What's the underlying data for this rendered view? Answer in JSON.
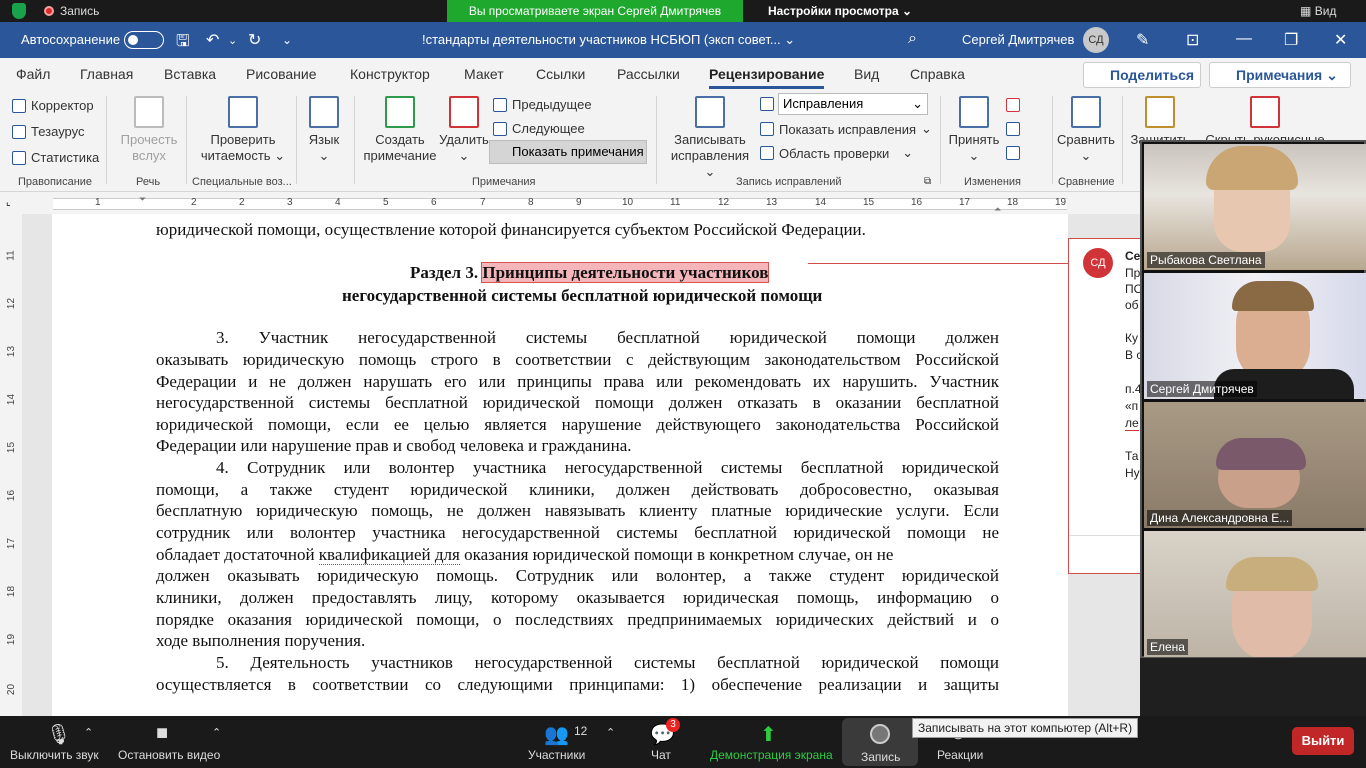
{
  "zoom_top": {
    "recording_label": "Запись",
    "viewing_banner": "Вы просматриваете экран Сергей Дмитрячев",
    "view_settings": "Настройки просмотра",
    "view_label": "Вид"
  },
  "word_title": {
    "autosave_label": "Автосохранение",
    "document_title": "!стандарты деятельности участников НСБЮП (эксп совет...",
    "user_name": "Сергей Дмитрячев",
    "user_initials": "СД"
  },
  "menu_tabs": [
    "Файл",
    "Главная",
    "Вставка",
    "Рисование",
    "Конструктор",
    "Макет",
    "Ссылки",
    "Рассылки",
    "Рецензирование",
    "Вид",
    "Справка"
  ],
  "share_button": "Поделиться",
  "comments_button": "Примечания",
  "ribbon": {
    "proofing": {
      "spelling": "Корректор",
      "thesaurus": "Тезаурус",
      "stats": "Статистика",
      "group": "Правописание"
    },
    "speech": {
      "read_aloud_1": "Прочесть",
      "read_aloud_2": "вслух",
      "group": "Речь"
    },
    "accessibility": {
      "check_1": "Проверить",
      "check_2": "читаемость",
      "group": "Специальные воз..."
    },
    "language": {
      "label": "Язык"
    },
    "comments": {
      "new_1": "Создать",
      "new_2": "примечание",
      "delete": "Удалить",
      "previous": "Предыдущее",
      "next": "Следующее",
      "show": "Показать примечания",
      "group": "Примечания"
    },
    "tracking": {
      "track_1": "Записывать",
      "track_2": "исправления",
      "markup_select": "Исправления",
      "show_markup": "Показать исправления",
      "review_pane": "Область проверки",
      "group": "Запись исправлений"
    },
    "changes": {
      "accept": "Принять",
      "group": "Изменения"
    },
    "compare": {
      "compare": "Сравнить",
      "group": "Сравнение"
    },
    "protect": {
      "protect": "Защитить"
    },
    "hide_ink": {
      "label": "Скрыть рукописные"
    }
  },
  "ruler_numbers": [
    "1",
    "2",
    "1",
    "2",
    "3",
    "4",
    "5",
    "6",
    "7",
    "8",
    "9",
    "10",
    "11",
    "12",
    "13",
    "14",
    "15",
    "16",
    "17",
    "18",
    "19"
  ],
  "vruler_numbers": [
    "11",
    "12",
    "13",
    "14",
    "15",
    "16",
    "17",
    "18",
    "19",
    "20"
  ],
  "document": {
    "line_top": "юридической помощи, осуществление которой финансируется субъектом Российской Федерации.",
    "heading_prefix": "Раздел 3. ",
    "heading_highlight": "Принципы деятельности участников",
    "heading_line2": "негосударственной системы бесплатной юридической помощи",
    "p3": [
      "3.      Участник негосударственной системы бесплатной юридической помощи должен",
      "оказывать юридическую помощь строго в соответствии с действующим законодательством Российской",
      "Федерации и не должен нарушать его или принципы права или рекомендовать их нарушить. Участник",
      "негосударственной системы бесплатной юридической помощи должен отказать в оказании бесплатной",
      "юридической помощи, если ее целью является нарушение действующего законодательства Российской"
    ],
    "p3_last": "Федерации или нарушение прав и свобод человека и гражданина.",
    "p4": [
      "4.      Сотрудник или волонтер участника негосударственной системы бесплатной юридической",
      "помощи, а также студент юридической клиники, должен действовать добросовестно, оказывая",
      "бесплатную юридическую помощь, не должен навязывать клиенту платные юридические услуги. Если",
      "сотрудник или волонтер участника негосударственной системы бесплатной юридической помощи не"
    ],
    "p4_l5_a": "обладает достаточной ",
    "p4_l5_ul": "квалификацией  для",
    "p4_l5_b": " оказания юридической помощи в конкретном случае, он не",
    "p4_rest": [
      "должен оказывать юридическую помощь. Сотрудник или волонтер, а также студент юридической",
      "клиники, должен предоставлять лицу, которому оказывается юридическая помощь, информацию о",
      "порядке оказания юридической помощи, о последствиях предпринимаемых юридических действий и о"
    ],
    "p4_last": "ходе выполнения поручения.",
    "p5": [
      "5.      Деятельность участников негосударственной системы бесплатной юридической помощи",
      "осуществляется в соответствии со следующими принципами: 1) обеспечение реализации и защиты"
    ]
  },
  "comment": {
    "initials": "СД",
    "lines": [
      "Се",
      "Пр",
      "ПО",
      "об",
      "",
      "Ку",
      "В с",
      "",
      "п.4",
      "«п",
      "ле",
      "",
      "Та",
      "Ну"
    ]
  },
  "participants": [
    {
      "name": "Рыбакова Светлана"
    },
    {
      "name": "Сергей Дмитрячев"
    },
    {
      "name": "Дина Александровна Е..."
    },
    {
      "name": "Елена"
    }
  ],
  "bottom_bar": {
    "mute": "Выключить звук",
    "stop_video": "Остановить видео",
    "participants": "Участники",
    "participants_count": "12",
    "chat": "Чат",
    "chat_badge": "3",
    "share": "Демонстрация экрана",
    "record": "Запись",
    "reactions": "Реакции",
    "exit": "Выйти",
    "tooltip": "Записывать на этот компьютер (Alt+R)"
  },
  "colors": {
    "word_blue": "#2b579a",
    "share_green": "#1fa82e",
    "exit_red": "#c22727",
    "highlight": "#f4b6bb"
  }
}
